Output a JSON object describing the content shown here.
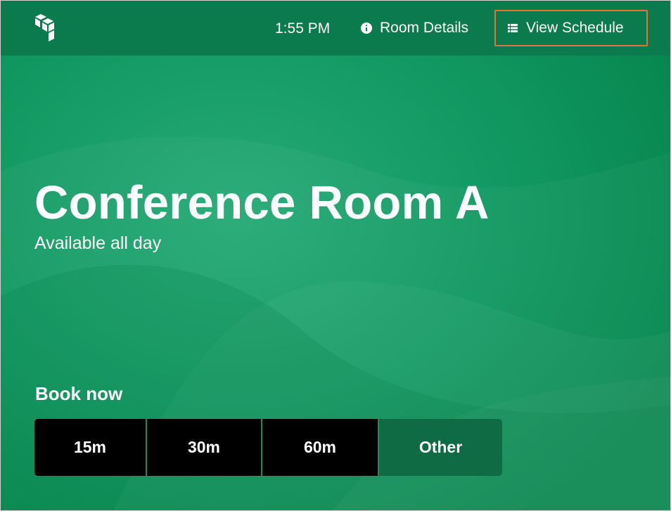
{
  "header": {
    "logo_icon": "stacked-cubes-logo",
    "time": "1:55 PM",
    "room_details_label": "Room Details",
    "room_details_icon": "info-circle-icon",
    "view_schedule_label": "View Schedule",
    "view_schedule_icon": "list-icon",
    "highlight_color": "#e8733a"
  },
  "room": {
    "name": "Conference Room A",
    "availability": "Available all day"
  },
  "booking": {
    "title": "Book now",
    "options": [
      {
        "label": "15m"
      },
      {
        "label": "30m"
      },
      {
        "label": "60m"
      },
      {
        "label": "Other"
      }
    ]
  },
  "colors": {
    "background": "#12995f",
    "header": "#0b7a4c",
    "button": "#000000",
    "other_button": "#0e6b43",
    "text": "#ffffff"
  }
}
